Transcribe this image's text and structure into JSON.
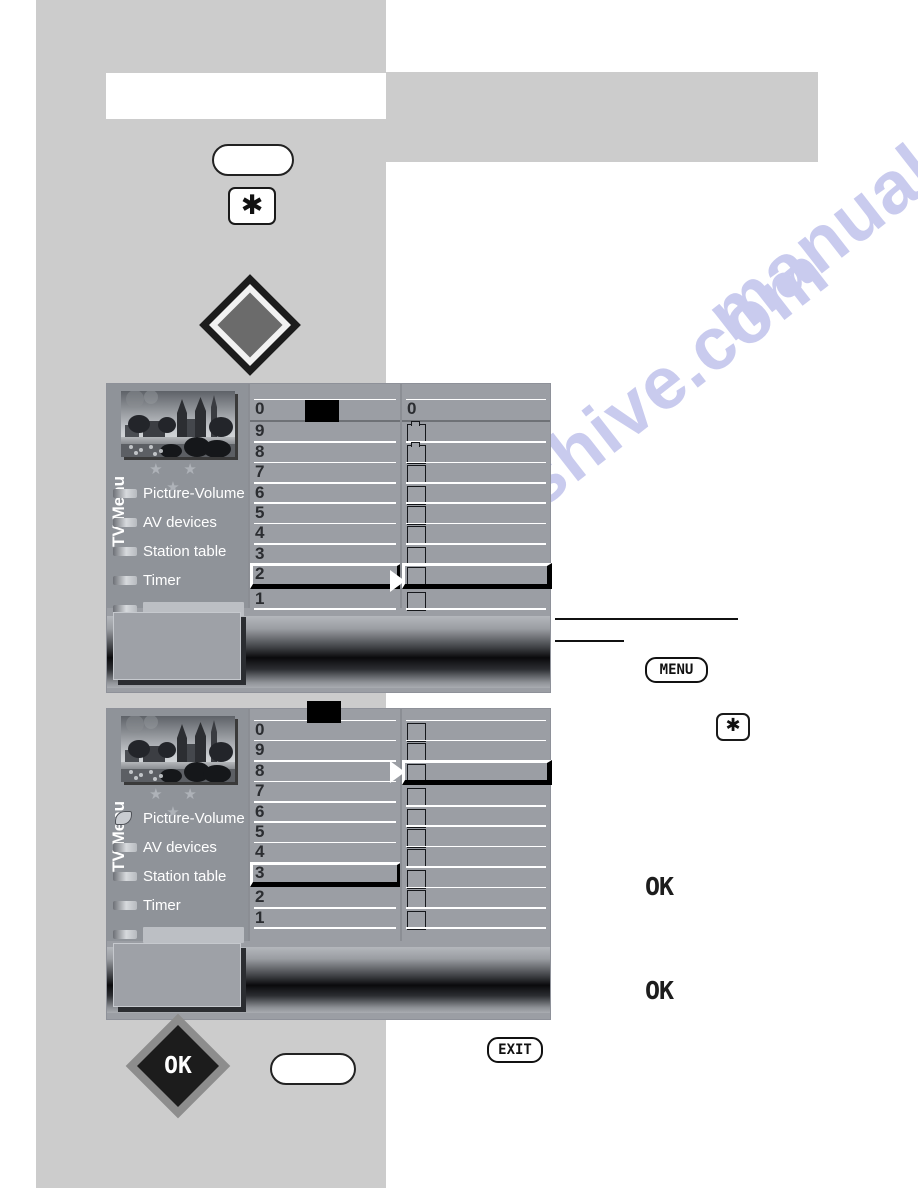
{
  "page": {
    "watermark": "manualshive.com"
  },
  "remote_keys": {
    "blank_pill_top": "",
    "star_top": "✱",
    "nav_pad": "nav-diamond",
    "ok_pad_label": "OK",
    "blank_pill_bottom": "",
    "menu_key": "MENU",
    "exit_key": "EXIT",
    "star_right": "✱",
    "ok_inline_1": "OK",
    "ok_inline_2": "OK"
  },
  "tv_screen_1": {
    "vertical_title": "TV-Menu",
    "rating_stars": "★ ★ ★",
    "menu_items": [
      {
        "label": "Picture-Volume",
        "icon": "tab-icon"
      },
      {
        "label": "AV devices",
        "icon": "tab-icon"
      },
      {
        "label": "Station table",
        "icon": "tab-icon"
      },
      {
        "label": "Timer",
        "icon": "tab-icon"
      },
      {
        "label": "",
        "icon": "tab-icon"
      }
    ],
    "column_left": {
      "header": "0",
      "rows": [
        "9",
        "8",
        "7",
        "6",
        "5",
        "4",
        "3",
        "2",
        "1"
      ],
      "selected_row": "2"
    },
    "column_right": {
      "header": "0",
      "row_count": 9,
      "selected_index": 7
    }
  },
  "tv_screen_2": {
    "vertical_title": "TV-Menu",
    "rating_stars": "★ ★ ★",
    "menu_items": [
      {
        "label": "Picture-Volume",
        "icon": "leaf-icon"
      },
      {
        "label": "AV devices",
        "icon": "tab-icon"
      },
      {
        "label": "Station table",
        "icon": "tab-icon"
      },
      {
        "label": "Timer",
        "icon": "tab-icon"
      },
      {
        "label": "",
        "icon": "tab-icon"
      }
    ],
    "column_left": {
      "rows": [
        "0",
        "9",
        "8",
        "7",
        "6",
        "5",
        "4",
        "3",
        "2",
        "1"
      ],
      "selected_row": "3"
    },
    "column_right": {
      "row_count": 10,
      "selected_index": 2
    }
  }
}
